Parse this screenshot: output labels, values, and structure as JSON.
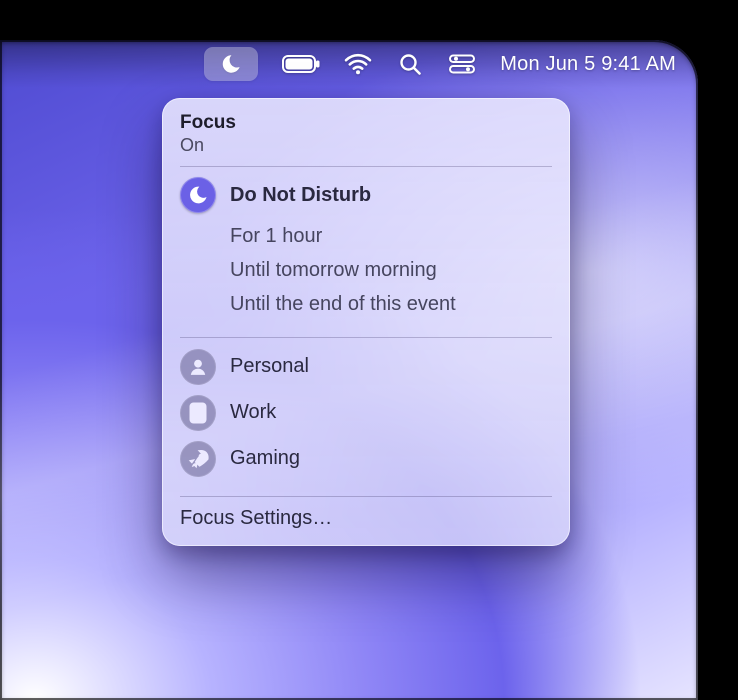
{
  "menubar": {
    "datetime": "Mon Jun 5  9:41 AM"
  },
  "panel": {
    "title": "Focus",
    "status": "On",
    "dnd": {
      "label": "Do Not Disturb",
      "options": [
        "For 1 hour",
        "Until tomorrow morning",
        "Until the end of this event"
      ]
    },
    "modes": [
      {
        "id": "personal",
        "label": "Personal",
        "icon": "person"
      },
      {
        "id": "work",
        "label": "Work",
        "icon": "badge"
      },
      {
        "id": "gaming",
        "label": "Gaming",
        "icon": "rocket"
      }
    ],
    "settings_label": "Focus Settings…"
  },
  "colors": {
    "accent": "#6b61e6",
    "panel_bg": "#e6e4ff",
    "text": "#262538"
  }
}
